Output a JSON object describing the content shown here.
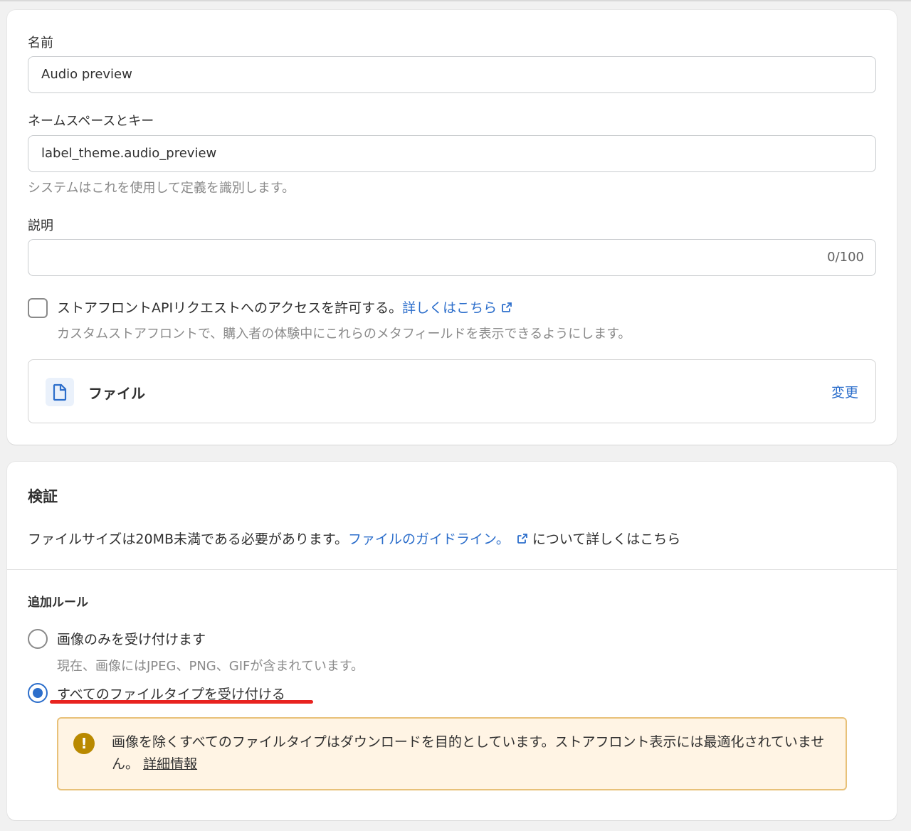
{
  "definition": {
    "name": {
      "label": "名前",
      "value": "Audio preview"
    },
    "namespace": {
      "label": "ネームスペースとキー",
      "value": "label_theme.audio_preview",
      "help": "システムはこれを使用して定義を識別します。"
    },
    "description": {
      "label": "説明",
      "value": "",
      "counter": "0/100"
    },
    "storefront_access": {
      "checked": false,
      "label": "ストアフロントAPIリクエストへのアクセスを許可する。",
      "link": "詳しくはこちら",
      "help": "カスタムストアフロントで、購入者の体験中にこれらのメタフィールドを表示できるようにします。"
    },
    "type": {
      "icon": "file-icon",
      "label": "ファイル",
      "change_link": "変更"
    }
  },
  "validation": {
    "title": "検証",
    "size_text": "ファイルサイズは20MB未満である必要があります。",
    "guideline_link": "ファイルのガイドライン。",
    "size_text_suffix": "について詳しくはこちら",
    "rules_title": "追加ルール",
    "options": [
      {
        "label": "画像のみを受け付けます",
        "help": "現在、画像にはJPEG、PNG、GIFが含まれています。",
        "selected": false
      },
      {
        "label": "すべてのファイルタイプを受け付ける",
        "selected": true
      }
    ],
    "warning": {
      "icon": "exclamation-icon",
      "text": "画像を除くすべてのファイルタイプはダウンロードを目的としています。ストアフロント表示には最適化されていません。",
      "link": "詳細情報"
    }
  },
  "colors": {
    "link": "#2c6ecb",
    "warning_bg": "#fff4e4",
    "warning_border": "#e8c179",
    "annotation": "#e8231f"
  }
}
